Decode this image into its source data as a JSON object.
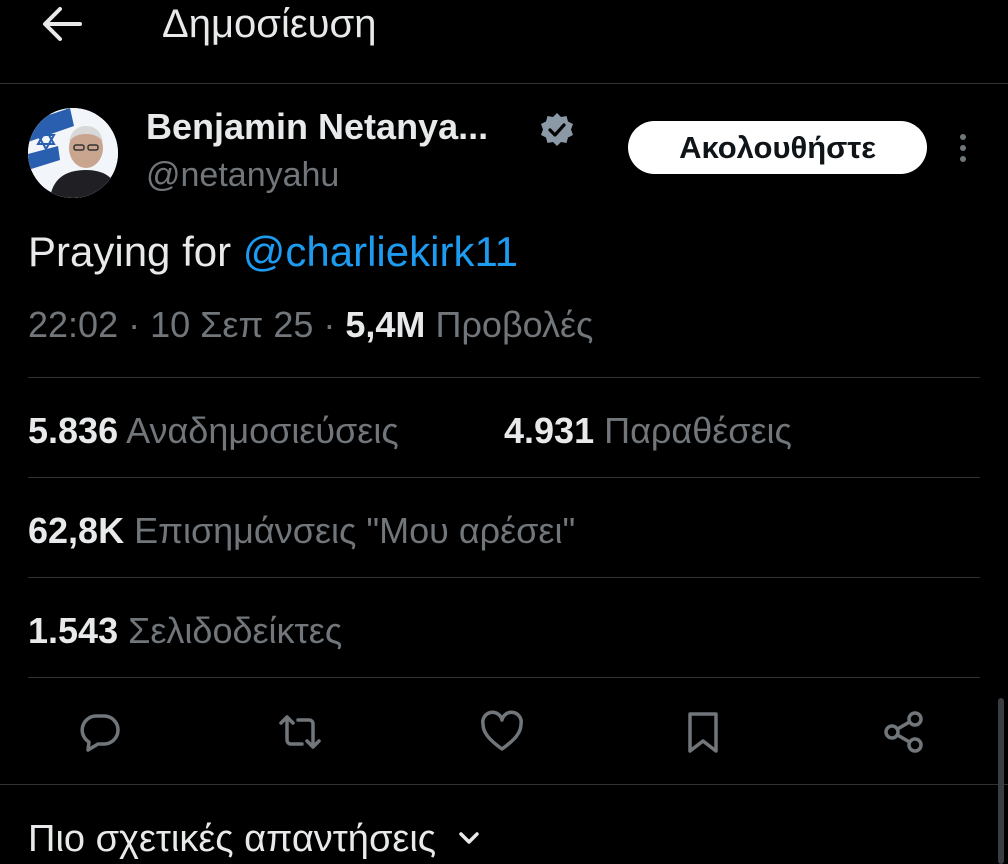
{
  "header": {
    "title": "Δημοσίευση"
  },
  "author": {
    "name": "Benjamin Netanya...",
    "handle": "@netanyahu",
    "follow_label": "Ακολουθήστε"
  },
  "post": {
    "text_prefix": "Praying for ",
    "mention": "@charliekirk11",
    "time": "22:02",
    "date": "10 Σεπ 25",
    "views": "5,4M",
    "views_label": "Προβολές",
    "separator": "·"
  },
  "stats": {
    "reposts_count": "5.836",
    "reposts_label": "Αναδημοσιεύσεις",
    "quotes_count": "4.931",
    "quotes_label": "Παραθέσεις",
    "likes_count": "62,8K",
    "likes_label": "Επισημάνσεις \"Μου αρέσει\"",
    "bookmarks_count": "1.543",
    "bookmarks_label": "Σελιδοδείκτες"
  },
  "replies": {
    "sort_label": "Πιο σχετικές απαντήσεις"
  },
  "colors": {
    "background": "#000000",
    "accent": "#1d9bf0",
    "secondary_text": "#71767b",
    "divider": "#2f3336",
    "verified_badge": "#8b98a5"
  },
  "icons": [
    "back-arrow-icon",
    "verified-badge-icon",
    "more-vertical-icon",
    "reply-icon",
    "repost-icon",
    "like-icon",
    "bookmark-icon",
    "share-icon",
    "chevron-down-icon"
  ]
}
